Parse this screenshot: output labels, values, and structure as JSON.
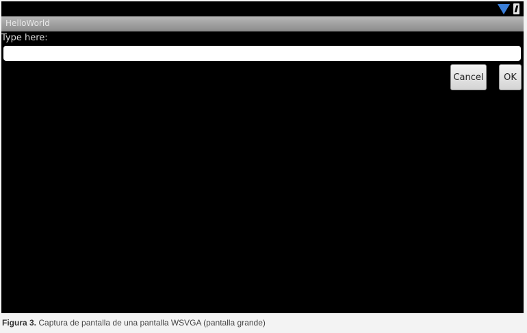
{
  "statusbar": {
    "icons": [
      "wifi-icon",
      "battery-icon"
    ],
    "wifi_color": "#3b7fd9"
  },
  "app": {
    "title": "HelloWorld"
  },
  "dialog": {
    "prompt": "Type here:",
    "input_value": "",
    "cancel_label": "Cancel",
    "ok_label": "OK"
  },
  "caption": {
    "label": "Figura 3.",
    "text": " Captura de pantalla de una pantalla WSVGA (pantalla grande)"
  }
}
